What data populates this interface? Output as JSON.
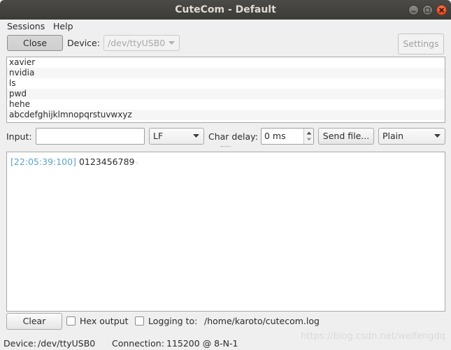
{
  "window": {
    "title": "CuteCom - Default"
  },
  "menubar": {
    "sessions": "Sessions",
    "help": "Help"
  },
  "toolbar": {
    "close_label": "Close",
    "device_label": "Device:",
    "device_value": "/dev/ttyUSB0",
    "settings_label": "Settings"
  },
  "history": {
    "items": [
      "xavier",
      "nvidia",
      "ls",
      "pwd",
      "hehe",
      "abcdefghijklmnopqrstuvwxyz"
    ]
  },
  "input_bar": {
    "input_label": "Input:",
    "input_value": "",
    "line_end_value": "LF",
    "char_delay_label": "Char delay:",
    "char_delay_value": "0 ms",
    "send_file_label": "Send file...",
    "mode_value": "Plain"
  },
  "output": {
    "lines": [
      {
        "timestamp": "[22:05:39:100]",
        "text": "0123456789",
        "ctrl": "␊"
      }
    ]
  },
  "bottom_bar": {
    "clear_label": "Clear",
    "hex_output_label": "Hex output",
    "logging_label": "Logging to:",
    "log_path": "/home/karoto/cutecom.log"
  },
  "statusbar": {
    "device_label": "Device:",
    "device_value": "/dev/ttyUSB0",
    "connection_label": "Connection:",
    "connection_value": "115200 @ 8-N-1"
  },
  "watermark": "https://blog.csdn.net/weifengdq"
}
